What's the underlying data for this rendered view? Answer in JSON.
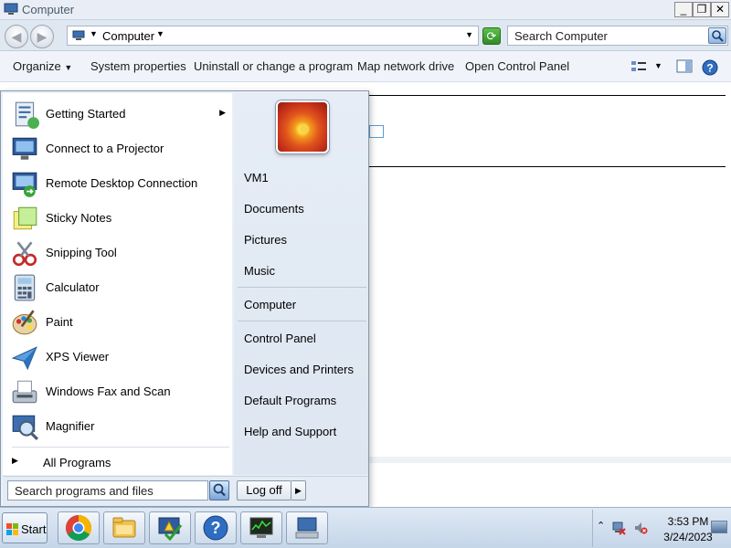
{
  "window": {
    "title": "Computer",
    "controls": {
      "minimize": "_",
      "maximize": "❐",
      "close": "✕"
    }
  },
  "address_bar": {
    "path": "Computer",
    "search_placeholder": "Search Computer"
  },
  "toolbar": {
    "organize": "Organize",
    "system_properties": "System properties",
    "uninstall": "Uninstall or change a program",
    "map_drive": "Map network drive",
    "control_panel": "Open Control Panel"
  },
  "start_menu": {
    "programs": [
      {
        "label": "Getting Started",
        "icon": "getting-started-icon",
        "has_submenu": true
      },
      {
        "label": "Connect to a Projector",
        "icon": "projector-icon",
        "has_submenu": false
      },
      {
        "label": "Remote Desktop Connection",
        "icon": "remote-desktop-icon",
        "has_submenu": false
      },
      {
        "label": "Sticky Notes",
        "icon": "sticky-notes-icon",
        "has_submenu": false
      },
      {
        "label": "Snipping Tool",
        "icon": "scissors-icon",
        "has_submenu": false
      },
      {
        "label": "Calculator",
        "icon": "calculator-icon",
        "has_submenu": false
      },
      {
        "label": "Paint",
        "icon": "paint-palette-icon",
        "has_submenu": false
      },
      {
        "label": "XPS Viewer",
        "icon": "xps-viewer-icon",
        "has_submenu": false
      },
      {
        "label": "Windows Fax and Scan",
        "icon": "fax-icon",
        "has_submenu": false
      },
      {
        "label": "Magnifier",
        "icon": "magnifier-icon",
        "has_submenu": false
      }
    ],
    "all_programs": "All Programs",
    "right_items": [
      "VM1",
      "Documents",
      "Pictures",
      "Music",
      "Computer",
      "Control Panel",
      "Devices and Printers",
      "Default Programs",
      "Help and Support"
    ],
    "search_placeholder": "Search programs and files",
    "logoff": "Log off"
  },
  "taskbar": {
    "start_label": "Start",
    "apps": [
      "chrome-icon",
      "explorer-folder-icon",
      "admin-tool-icon",
      "help-icon",
      "task-manager-icon",
      "network-computer-icon"
    ],
    "time": "3:53 PM",
    "date": "3/24/2023"
  },
  "colors": {
    "accent": "#3a6ea5",
    "start_menu_bg": "#eaf0f7",
    "taskbar_bg": "#c5d5e8"
  }
}
